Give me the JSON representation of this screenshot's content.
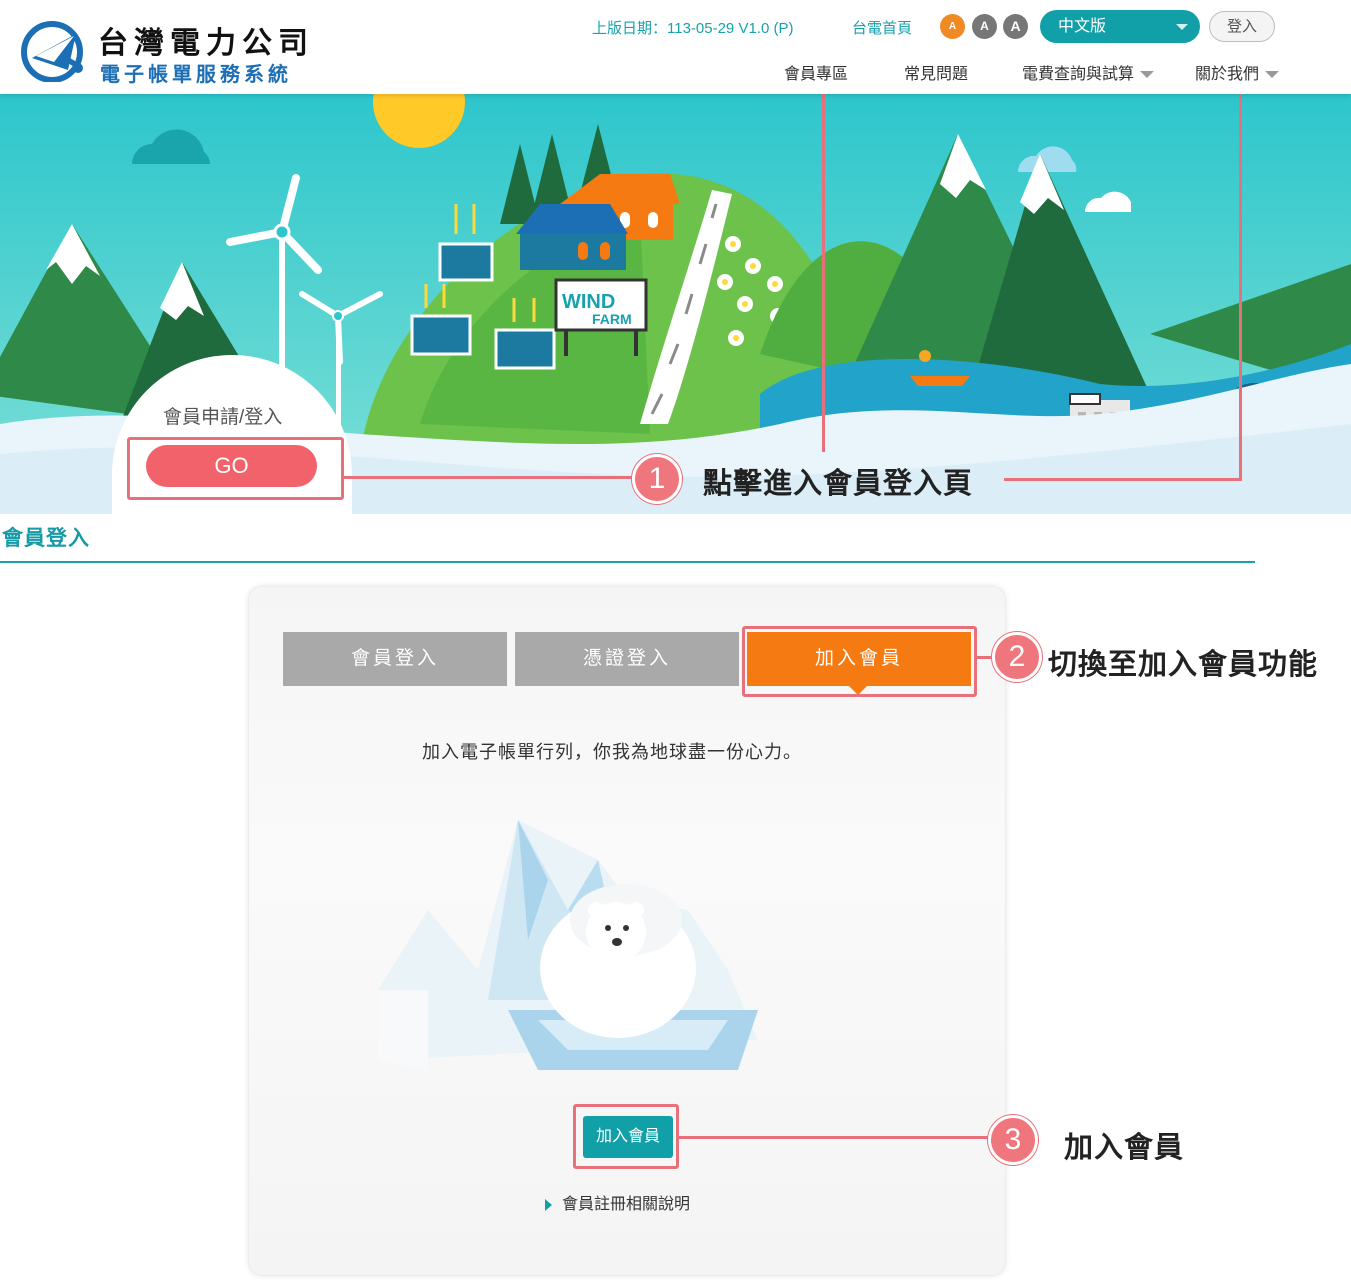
{
  "header": {
    "logo_title": "台灣電力公司",
    "logo_subtitle": "電子帳單服務系統",
    "version": "上版日期：113-05-29 V1.0 (P)",
    "homepage_link": "台電首頁",
    "font_size_buttons": [
      "A",
      "A",
      "A"
    ],
    "language": "中文版",
    "login_button": "登入",
    "nav": [
      "會員專區",
      "常見問題",
      "電費查詢與試算",
      "關於我們"
    ]
  },
  "banner": {
    "dome_text": "會員申請/登入",
    "go_button": "GO",
    "sign_line1": "WIND",
    "sign_line2": "FARM"
  },
  "section": {
    "title": "會員登入"
  },
  "card": {
    "tabs": [
      "會員登入",
      "憑證登入",
      "加入會員"
    ],
    "active_tab": "加入會員",
    "slogan": "加入電子帳單行列，你我為地球盡一份心力。",
    "join_button": "加入會員",
    "help_link": "會員註冊相關說明"
  },
  "annotations": [
    {
      "number": "1",
      "text": "點擊進入會員登入頁"
    },
    {
      "number": "2",
      "text": "切換至加入會員功能"
    },
    {
      "number": "3",
      "text": "加入會員"
    }
  ],
  "colors": {
    "teal": "#12a0a8",
    "orange": "#f57a12",
    "annotation_red": "#e8707a",
    "go_red": "#f2626a"
  }
}
